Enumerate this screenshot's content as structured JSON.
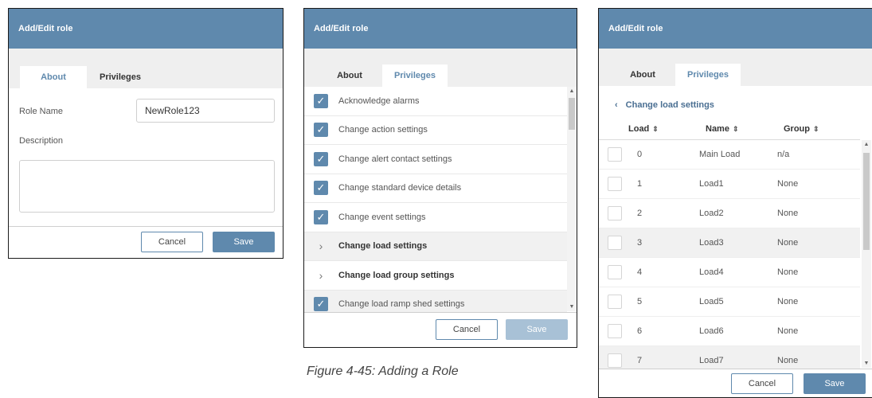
{
  "panel1": {
    "title": "Add/Edit role",
    "tabs": [
      {
        "label": "About",
        "active": true
      },
      {
        "label": "Privileges",
        "active": false
      }
    ],
    "role_name_label": "Role Name",
    "role_name_value": "NewRole123",
    "description_label": "Description",
    "description_value": "",
    "cancel": "Cancel",
    "save": "Save"
  },
  "panel2": {
    "title": "Add/Edit role",
    "tabs": [
      {
        "label": "About",
        "active": false
      },
      {
        "label": "Privileges",
        "active": true
      }
    ],
    "items": [
      {
        "label": "Acknowledge alarms",
        "kind": "checked"
      },
      {
        "label": "Change action settings",
        "kind": "checked"
      },
      {
        "label": "Change alert contact settings",
        "kind": "checked"
      },
      {
        "label": "Change standard device details",
        "kind": "checked"
      },
      {
        "label": "Change event settings",
        "kind": "checked"
      },
      {
        "label": "Change load settings",
        "kind": "expand"
      },
      {
        "label": "Change load group settings",
        "kind": "expand"
      },
      {
        "label": "Change load ramp shed settings",
        "kind": "checked"
      }
    ],
    "cancel": "Cancel",
    "save": "Save"
  },
  "panel3": {
    "title": "Add/Edit role",
    "tabs": [
      {
        "label": "About",
        "active": false
      },
      {
        "label": "Privileges",
        "active": true
      }
    ],
    "back_label": "Change load settings",
    "columns": [
      "Load",
      "Name",
      "Group"
    ],
    "rows": [
      [
        "0",
        "Main Load",
        "n/a"
      ],
      [
        "1",
        "Load1",
        "None"
      ],
      [
        "2",
        "Load2",
        "None"
      ],
      [
        "3",
        "Load3",
        "None"
      ],
      [
        "4",
        "Load4",
        "None"
      ],
      [
        "5",
        "Load5",
        "None"
      ],
      [
        "6",
        "Load6",
        "None"
      ],
      [
        "7",
        "Load7",
        "None"
      ]
    ],
    "cancel": "Cancel",
    "save": "Save"
  },
  "caption": "Figure 4-45: Adding a Role"
}
